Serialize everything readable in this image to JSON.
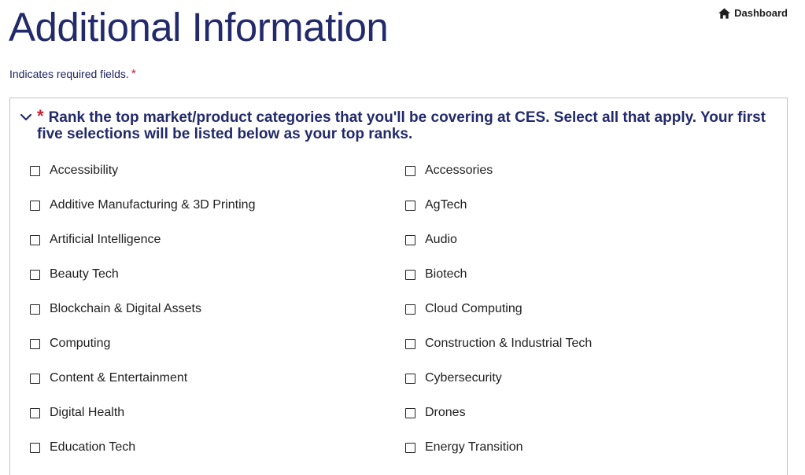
{
  "header": {
    "title": "Additional Information",
    "dashboard_label": "Dashboard"
  },
  "required_note": {
    "text": "Indicates required fields.",
    "star": "*"
  },
  "question": {
    "star": "*",
    "text": "Rank the top market/product categories that you'll be covering at CES. Select all that apply. Your first five selections will be listed below as your top ranks."
  },
  "options": [
    "Accessibility",
    "Accessories",
    "Additive Manufacturing & 3D Printing",
    "AgTech",
    "Artificial Intelligence",
    "Audio",
    "Beauty Tech",
    "Biotech",
    "Blockchain & Digital Assets",
    "Cloud Computing",
    "Computing",
    "Construction & Industrial Tech",
    "Content & Entertainment",
    "Cybersecurity",
    "Digital Health",
    "Drones",
    "Education Tech",
    "Energy Transition"
  ],
  "colors": {
    "title": "#222a6b",
    "required": "#c8202f",
    "border": "#c4c4c4"
  }
}
